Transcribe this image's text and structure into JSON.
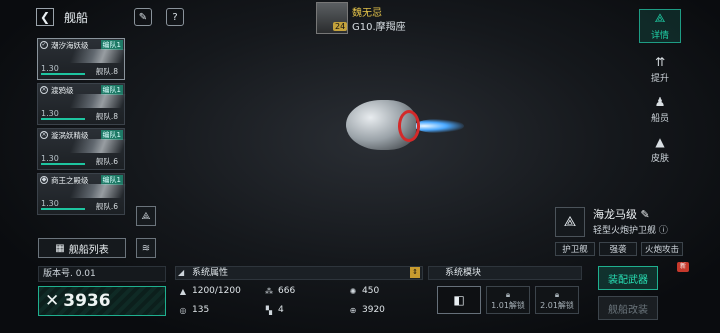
{
  "header": {
    "back_icon": "chevron-left-icon",
    "title": "舰船",
    "commander_name": "魏无忌",
    "commander_level": "24",
    "location": "G10.摩羯座"
  },
  "ships": [
    {
      "name": "潮汐海妖级",
      "fleet_tag": "编队1",
      "level": "1.30",
      "fleet": "舰队.8"
    },
    {
      "name": "渡鸦级",
      "fleet_tag": "编队1",
      "level": "1.30",
      "fleet": "舰队.8"
    },
    {
      "name": "漩涡妖精级",
      "fleet_tag": "编队1",
      "level": "1.30",
      "fleet": "舰队.6"
    },
    {
      "name": "商王之殿级",
      "fleet_tag": "编队1",
      "level": "1.30",
      "fleet": "舰队.6"
    }
  ],
  "ship_list_button": "舰船列表",
  "side_tabs": [
    {
      "label": "详情",
      "icon": "fleet-icon"
    },
    {
      "label": "提升",
      "icon": "upgrade-icon"
    },
    {
      "label": "船员",
      "icon": "crew-icon"
    },
    {
      "label": "皮肤",
      "icon": "skin-icon"
    }
  ],
  "ship_info": {
    "name": "海龙马级",
    "type": "轻型火炮护卫舰",
    "chips": [
      "护卫舰",
      "强袭",
      "火炮攻击"
    ]
  },
  "version": "版本号. 0.01",
  "power": "3936",
  "attributes": {
    "title": "系统属性",
    "items": [
      {
        "icon": "armor-icon",
        "value": "1200/1200"
      },
      {
        "icon": "cargo-icon",
        "value": "666"
      },
      {
        "icon": "speed-icon",
        "value": "450"
      },
      {
        "icon": "shield-icon",
        "value": "135"
      },
      {
        "icon": "grid-icon",
        "value": "4"
      },
      {
        "icon": "range-icon",
        "value": "3920"
      }
    ]
  },
  "modules": {
    "title": "系统模块",
    "slots": [
      {
        "label": ""
      },
      {
        "label": "1.01解锁"
      },
      {
        "label": "2.01解锁"
      }
    ]
  },
  "actions": {
    "equip": "装配武器",
    "modify": "舰船改装",
    "new_badge": "新"
  }
}
